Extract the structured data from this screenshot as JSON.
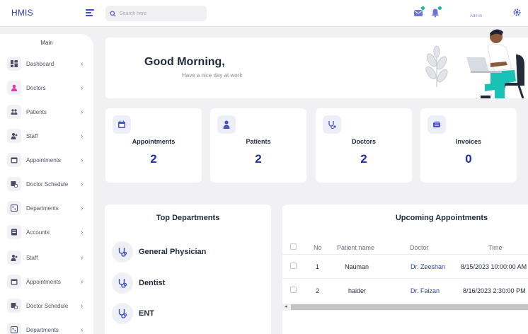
{
  "header": {
    "logo": "HMIS",
    "search_placeholder": "Search here",
    "user_name": "Admin"
  },
  "sidebar": {
    "title": "Main",
    "items": [
      {
        "label": "Dashboard",
        "icon": "dashboard-icon"
      },
      {
        "label": "Doctors",
        "icon": "doctor-icon"
      },
      {
        "label": "Patients",
        "icon": "patients-icon"
      },
      {
        "label": "Staff",
        "icon": "staff-icon"
      },
      {
        "label": "Appointments",
        "icon": "calendar-icon"
      },
      {
        "label": "Doctor Schedule",
        "icon": "schedule-icon"
      },
      {
        "label": "Departments",
        "icon": "departments-icon"
      },
      {
        "label": "Accounts",
        "icon": "accounts-icon"
      },
      {
        "label": "Staff",
        "icon": "staff-icon"
      },
      {
        "label": "Appointments",
        "icon": "calendar-icon"
      },
      {
        "label": "Doctor Schedule",
        "icon": "schedule-icon"
      },
      {
        "label": "Departments",
        "icon": "departments-icon"
      }
    ]
  },
  "welcome": {
    "greeting": "Good Morning,",
    "subtitle": "Have a nice day at work"
  },
  "stats": [
    {
      "label": "Appointments",
      "value": "2",
      "icon": "calendar-icon"
    },
    {
      "label": "Patients",
      "value": "2",
      "icon": "patient-icon"
    },
    {
      "label": "Doctors",
      "value": "2",
      "icon": "doctor-icon"
    },
    {
      "label": "Invoices",
      "value": "0",
      "icon": "invoice-icon"
    }
  ],
  "departments": {
    "title": "Top Departments",
    "items": [
      "General Physician",
      "Dentist",
      "ENT"
    ]
  },
  "appointments": {
    "title": "Upcoming Appointments",
    "columns": [
      "No",
      "Patient name",
      "Doctor",
      "Time"
    ],
    "rows": [
      {
        "no": "1",
        "patient": "Nauman",
        "doctor": "Dr. Zeeshan",
        "time": "8/15/2023 10:00:00 AM"
      },
      {
        "no": "2",
        "patient": "haider",
        "doctor": "Dr. Faizan",
        "time": "8/16/2023 2:30:00 PM"
      }
    ]
  },
  "colors": {
    "accent": "#2f3cc4",
    "stat_value": "#2330a0",
    "notify_dot": "#14b8a6",
    "illustration_teal": "#18c2b5"
  }
}
